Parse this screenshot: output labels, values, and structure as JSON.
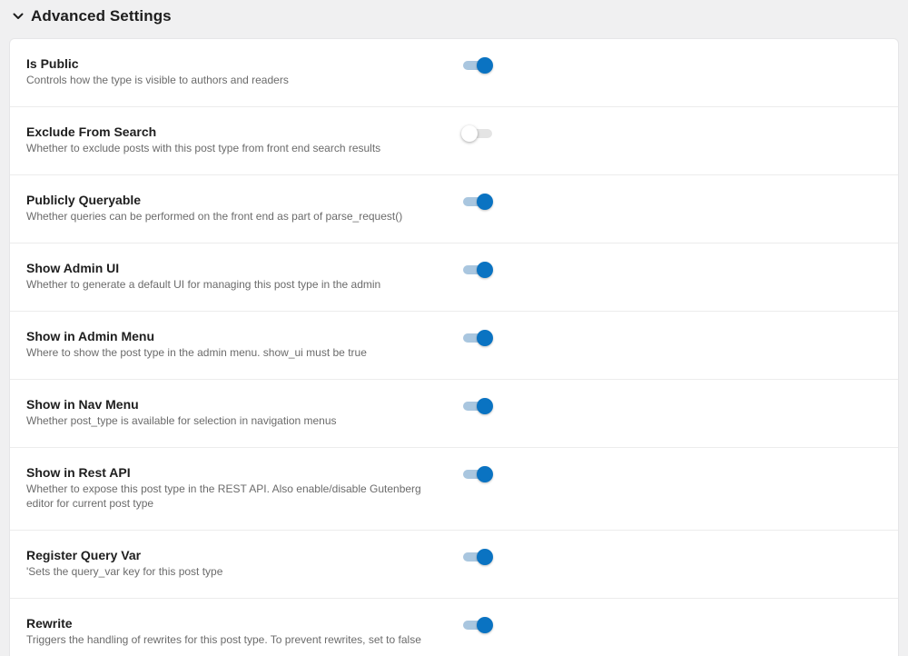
{
  "panel": {
    "title": "Advanced Settings",
    "chevron_icon": "chevron-down-icon"
  },
  "colors": {
    "toggle_on": "#0a73c2",
    "toggle_on_track": "#a9c6df",
    "toggle_off_track": "#e4e4e4"
  },
  "settings": [
    {
      "label": "Is Public",
      "description": "Controls how the type is visible to authors and readers",
      "enabled": true
    },
    {
      "label": "Exclude From Search",
      "description": "Whether to exclude posts with this post type from front end search results",
      "enabled": false
    },
    {
      "label": "Publicly Queryable",
      "description": "Whether queries can be performed on the front end as part of parse_request()",
      "enabled": true
    },
    {
      "label": "Show Admin UI",
      "description": "Whether to generate a default UI for managing this post type in the admin",
      "enabled": true
    },
    {
      "label": "Show in Admin Menu",
      "description": "Where to show the post type in the admin menu. show_ui must be true",
      "enabled": true
    },
    {
      "label": "Show in Nav Menu",
      "description": "Whether post_type is available for selection in navigation menus",
      "enabled": true
    },
    {
      "label": "Show in Rest API",
      "description": "Whether to expose this post type in the REST API. Also enable/disable Gutenberg editor for current post type",
      "enabled": true
    },
    {
      "label": "Register Query Var",
      "description": "'Sets the query_var key for this post type",
      "enabled": true
    },
    {
      "label": "Rewrite",
      "description": "Triggers the handling of rewrites for this post type. To prevent rewrites, set to false",
      "enabled": true
    }
  ]
}
